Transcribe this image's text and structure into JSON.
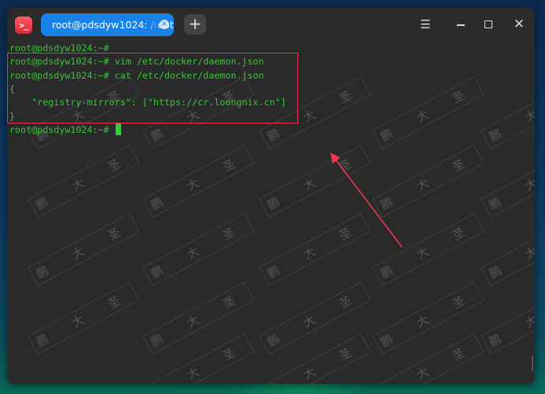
{
  "window": {
    "tab_title": "root@pdsdyw1024: /root",
    "app_icon_glyph": ">_",
    "tab_close_glyph": "×",
    "new_tab_glyph": "+",
    "menu_glyph": "☰",
    "close_glyph": "✕"
  },
  "terminal": {
    "lines": [
      "root@pdsdyw1024:~#",
      "root@pdsdyw1024:~# vim /etc/docker/daemon.json",
      "root@pdsdyw1024:~# cat /etc/docker/daemon.json",
      "{",
      "    \"registry-mirrors\": [\"https://cr.loongnix.cn\"]",
      "}",
      "root@pdsdyw1024:~#"
    ]
  },
  "watermark": {
    "text": "鹏 大 圣"
  },
  "colors": {
    "terminal_text": "#3cc23c",
    "highlight_box": "#e8384f",
    "tab_active": "#1a82e6",
    "terminal_bg": "#2a2a2a"
  }
}
